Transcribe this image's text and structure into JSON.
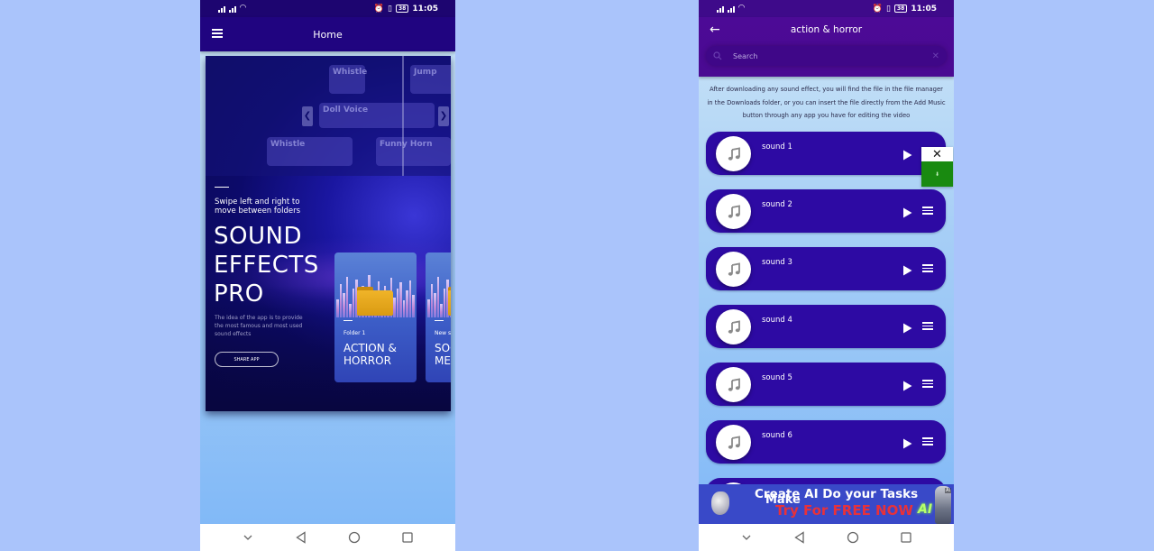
{
  "status_bar": {
    "time": "11:05",
    "battery": "38",
    "icons": [
      "signal-icon",
      "signal-icon",
      "wifi-icon",
      "alarm-icon",
      "vibrate-icon",
      "battery-icon"
    ]
  },
  "home_screen": {
    "appbar": {
      "title": "Home",
      "menu_icon": "hamburger-menu-icon"
    },
    "hero": {
      "background_preview_labels": [
        "Whistle",
        "Jump",
        "Doll Voice",
        "Whistle",
        "Funny Horn"
      ],
      "swipe_hint": "Swipe left and right to move between folders",
      "title": "SOUND EFFECTS PRO",
      "description": "The idea of the app is to provide the most famous and most used sound effects",
      "share_button": "SHARE APP"
    },
    "folders": [
      {
        "subtitle": "Folder 1",
        "title": "ACTION &\nHORROR",
        "icon": "folder-icon"
      },
      {
        "subtitle": "New s",
        "title": "SOC\nME",
        "icon": "folder-icon"
      }
    ]
  },
  "sound_list_screen": {
    "appbar": {
      "title": "action & horror",
      "back_icon": "arrow-left-icon"
    },
    "search": {
      "placeholder": "Search",
      "value": ""
    },
    "info_text": "After downloading any sound effect, you will find the file in the file manager in the Downloads folder, or you can insert the file directly from the Add Music button through any app you have for editing the video",
    "sounds": [
      {
        "name": "sound 1"
      },
      {
        "name": "sound 2"
      },
      {
        "name": "sound 3"
      },
      {
        "name": "sound 4"
      },
      {
        "name": "sound 5"
      },
      {
        "name": "sound 6"
      }
    ],
    "download_popup": {
      "close_label": "✕",
      "download_label": "⬇"
    },
    "ad": {
      "line1": "Create  AI Do your Tasks",
      "line1_overlay": "Make",
      "line2": "Try For FREE NOW",
      "badge": "AI",
      "ai_label": "AI"
    }
  },
  "navigation_bar": {
    "buttons": [
      "collapse",
      "back",
      "home",
      "recents"
    ]
  },
  "colors": {
    "page_background": "#aac4fb",
    "home_appbar": "#200480",
    "list_appbar": "#4c0a96",
    "sound_item": "#2d0aa3",
    "download_green": "#198a10",
    "ad_background": "#3949c8",
    "ad_red": "#e8313a"
  }
}
